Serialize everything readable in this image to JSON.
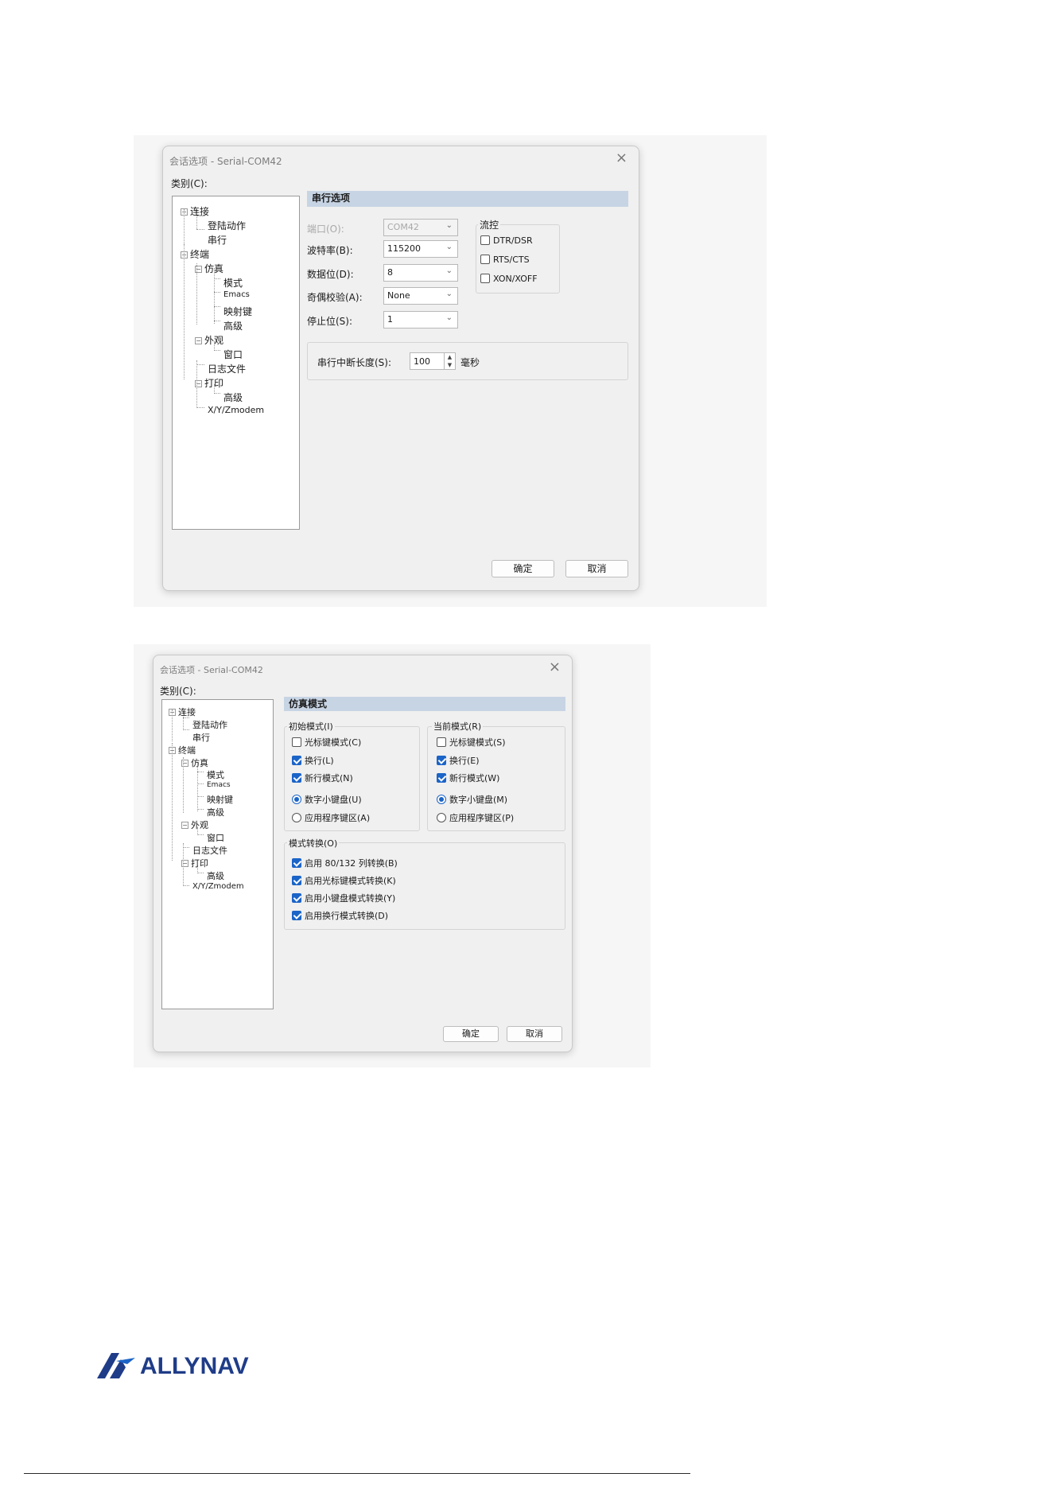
{
  "dialog1": {
    "title": "会话选项 - Serial-COM42",
    "close_glyph": "×",
    "category_label": "类别(C):",
    "tree": [
      "连接",
      "登陆动作",
      "串行",
      "终端",
      "仿真",
      "模式",
      "Emacs",
      "映射键",
      "高级",
      "外观",
      "窗口",
      "日志文件",
      "打印",
      "高级",
      "X/Y/Zmodem"
    ],
    "expander": "⊟",
    "section_title": "串行选项",
    "port_label": "端口(O):",
    "port_value": "COM42",
    "baud_label": "波特率(B):",
    "baud_value": "115200",
    "databits_label": "数据位(D):",
    "databits_value": "8",
    "parity_label": "奇偶校验(A):",
    "parity_value": "None",
    "stopbits_label": "停止位(S):",
    "stopbits_value": "1",
    "flow_title": "流控",
    "flow_items": [
      {
        "label": "DTR/DSR",
        "checked": false
      },
      {
        "label": "RTS/CTS",
        "checked": false
      },
      {
        "label": "XON/XOFF",
        "checked": false
      }
    ],
    "break_label": "串行中断长度(S):",
    "break_value": "100",
    "break_unit": "毫秒",
    "ok": "确定",
    "cancel": "取消"
  },
  "dialog2": {
    "title": "会话选项 - Serial-COM42",
    "close_glyph": "×",
    "category_label": "类别(C):",
    "tree": [
      "连接",
      "登陆动作",
      "串行",
      "终端",
      "仿真",
      "模式",
      "Emacs",
      "映射键",
      "高级",
      "外观",
      "窗口",
      "日志文件",
      "打印",
      "高级",
      "X/Y/Zmodem"
    ],
    "expander": "⊟",
    "section_title": "仿真模式",
    "initial_group": "初始模式(I)",
    "initial_items": [
      {
        "label": "光标键模式(C)",
        "type": "check",
        "checked": false
      },
      {
        "label": "换行(L)",
        "type": "check",
        "checked": true
      },
      {
        "label": "新行模式(N)",
        "type": "check",
        "checked": true
      },
      {
        "label": "数字小键盘(U)",
        "type": "radio",
        "checked": true
      },
      {
        "label": "应用程序键区(A)",
        "type": "radio",
        "checked": false
      }
    ],
    "current_group": "当前模式(R)",
    "current_items": [
      {
        "label": "光标键模式(S)",
        "type": "check",
        "checked": false
      },
      {
        "label": "换行(E)",
        "type": "check",
        "checked": true
      },
      {
        "label": "新行模式(W)",
        "type": "check",
        "checked": true
      },
      {
        "label": "数字小键盘(M)",
        "type": "radio",
        "checked": true
      },
      {
        "label": "应用程序键区(P)",
        "type": "radio",
        "checked": false
      }
    ],
    "switch_group": "模式转换(O)",
    "switch_items": [
      {
        "label": "启用 80/132 列转换(B)",
        "checked": true
      },
      {
        "label": "启用光标键模式转换(K)",
        "checked": true
      },
      {
        "label": "启用小键盘模式转换(Y)",
        "checked": true
      },
      {
        "label": "启用换行模式转换(D)",
        "checked": true
      }
    ],
    "ok": "确定",
    "cancel": "取消"
  },
  "footer": {
    "brand": "ALLYNAV",
    "brand_color": "#1f3c88",
    "accent_color": "#1b64c8"
  }
}
